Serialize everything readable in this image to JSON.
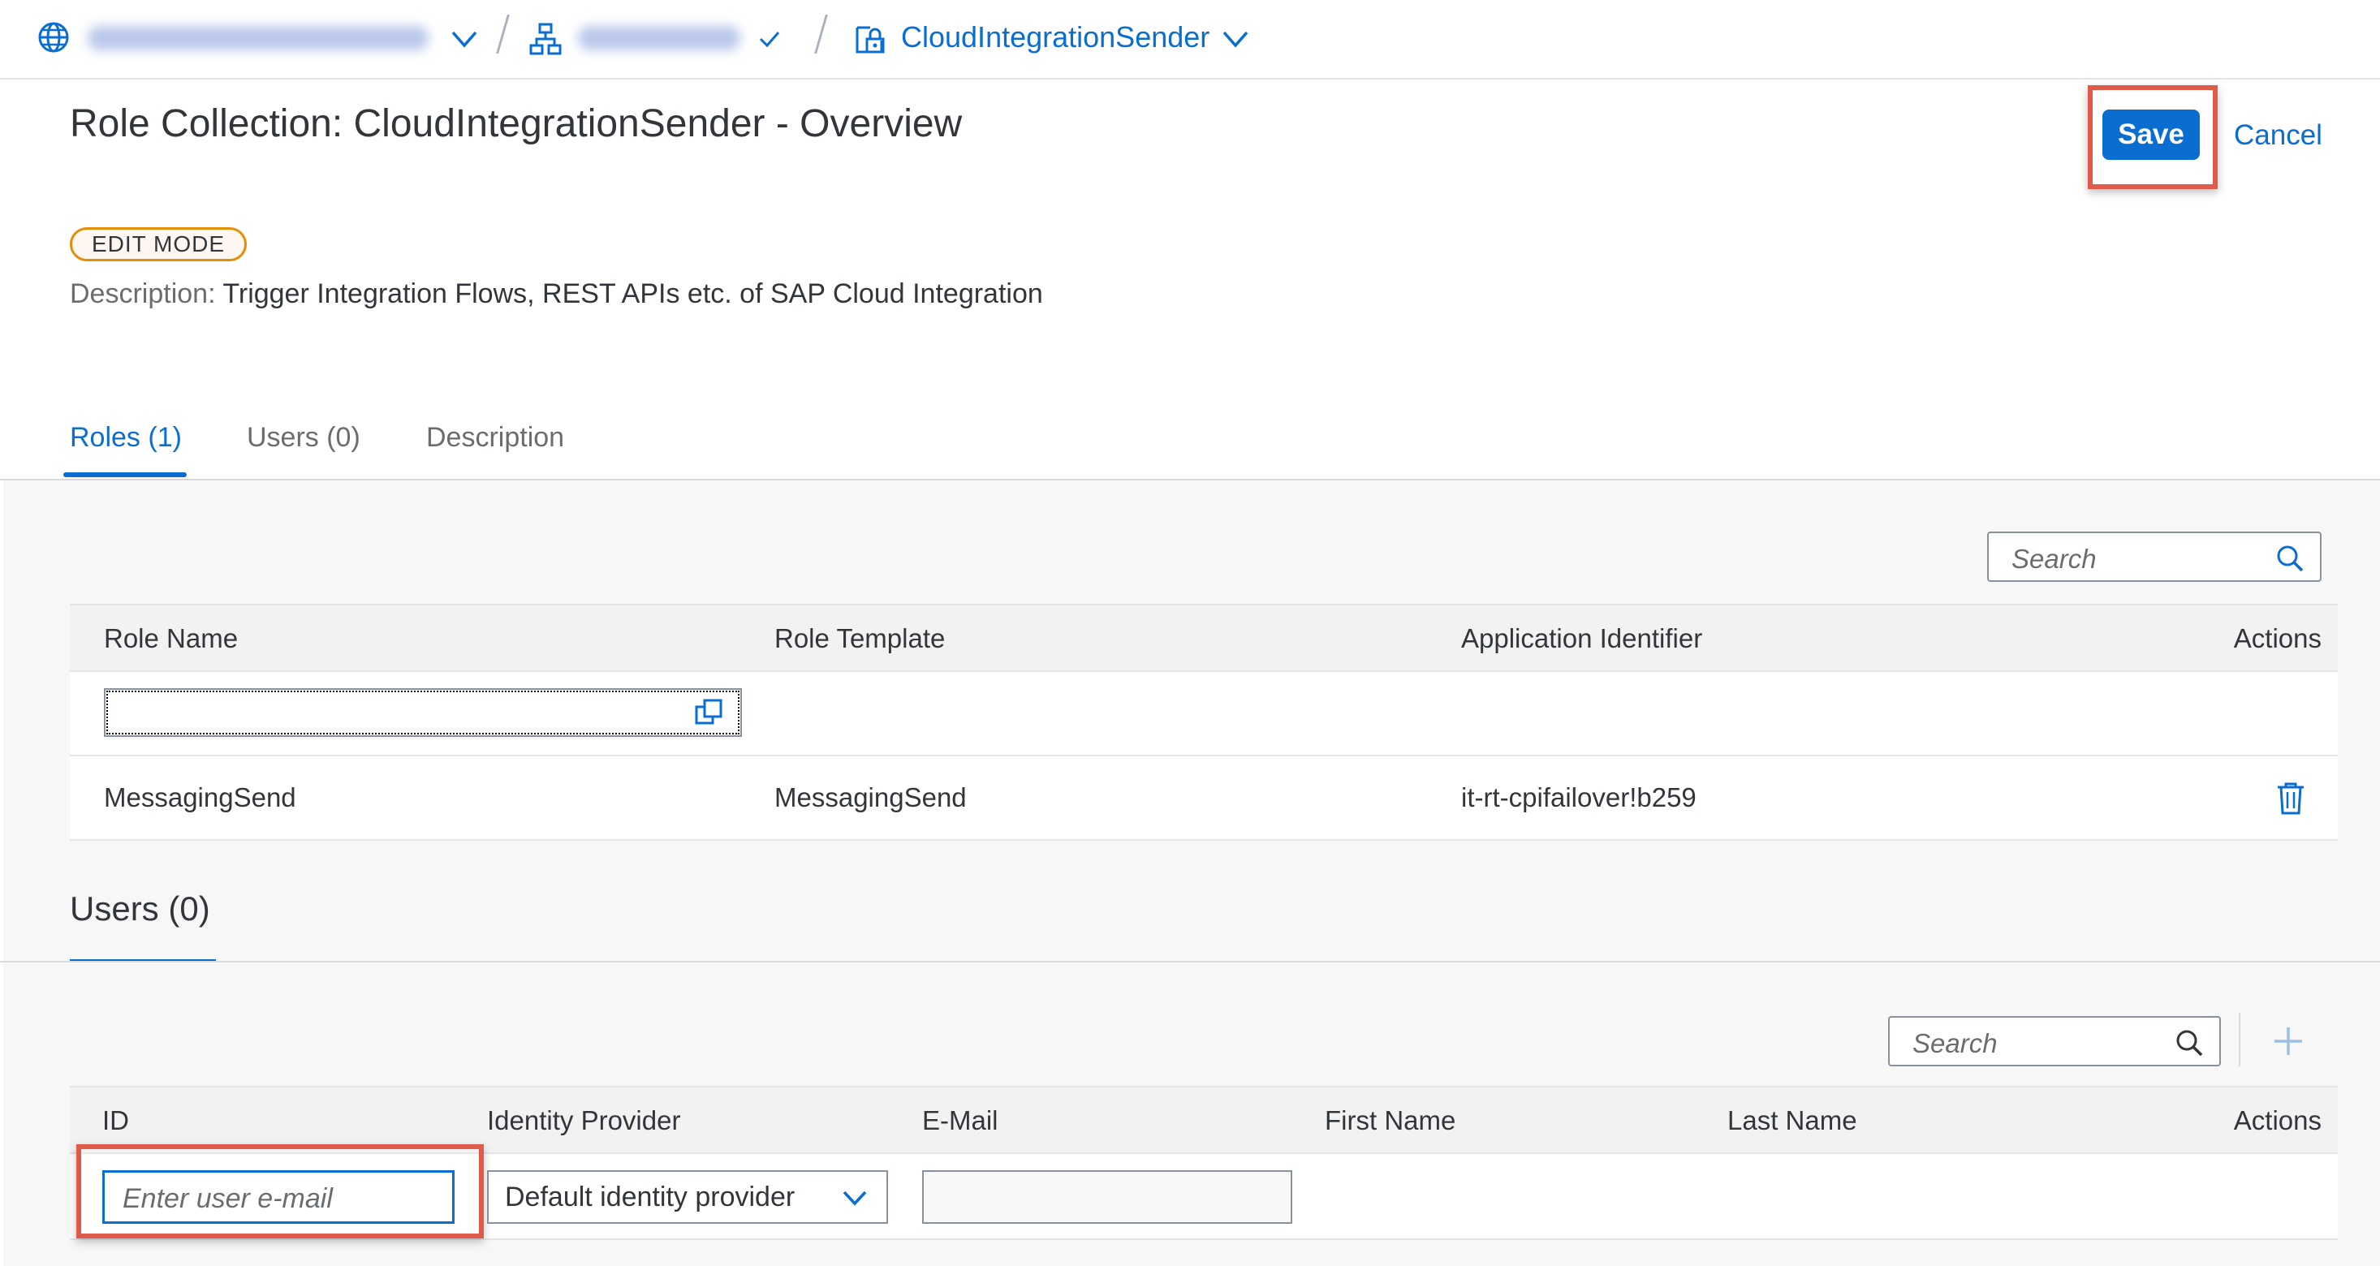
{
  "breadcrumb": {
    "item3_label": "CloudIntegrationSender"
  },
  "header": {
    "title": "Role Collection: CloudIntegrationSender - Overview",
    "save_label": "Save",
    "cancel_label": "Cancel",
    "mode_badge": "EDIT MODE",
    "description_key": "Description:",
    "description_value": "Trigger Integration Flows, REST APIs etc. of SAP Cloud Integration"
  },
  "tabs": [
    {
      "label": "Roles (1)",
      "active": true
    },
    {
      "label": "Users (0)",
      "active": false
    },
    {
      "label": "Description",
      "active": false
    }
  ],
  "roles_table": {
    "search_placeholder": "Search",
    "columns": [
      "Role Name",
      "Role Template",
      "Application Identifier",
      "Actions"
    ],
    "rows": [
      {
        "role_name": "MessagingSend",
        "role_template": "MessagingSend",
        "app_id": "it-rt-cpifailover!b259"
      }
    ]
  },
  "users_section": {
    "title": "Users (0)",
    "search_placeholder": "Search",
    "columns": [
      "ID",
      "Identity Provider",
      "E-Mail",
      "First Name",
      "Last Name",
      "Actions"
    ],
    "id_placeholder": "Enter user e-mail",
    "identity_provider_value": "Default identity provider"
  },
  "colors": {
    "accent": "#0a6ed1",
    "highlight": "#e05a4a",
    "badge_border": "#e78c07"
  },
  "icons": [
    "globe-icon",
    "chevron-down-icon",
    "hierarchy-icon",
    "check-icon",
    "lock-icon",
    "search-icon",
    "value-help-icon",
    "delete-icon",
    "add-icon"
  ]
}
